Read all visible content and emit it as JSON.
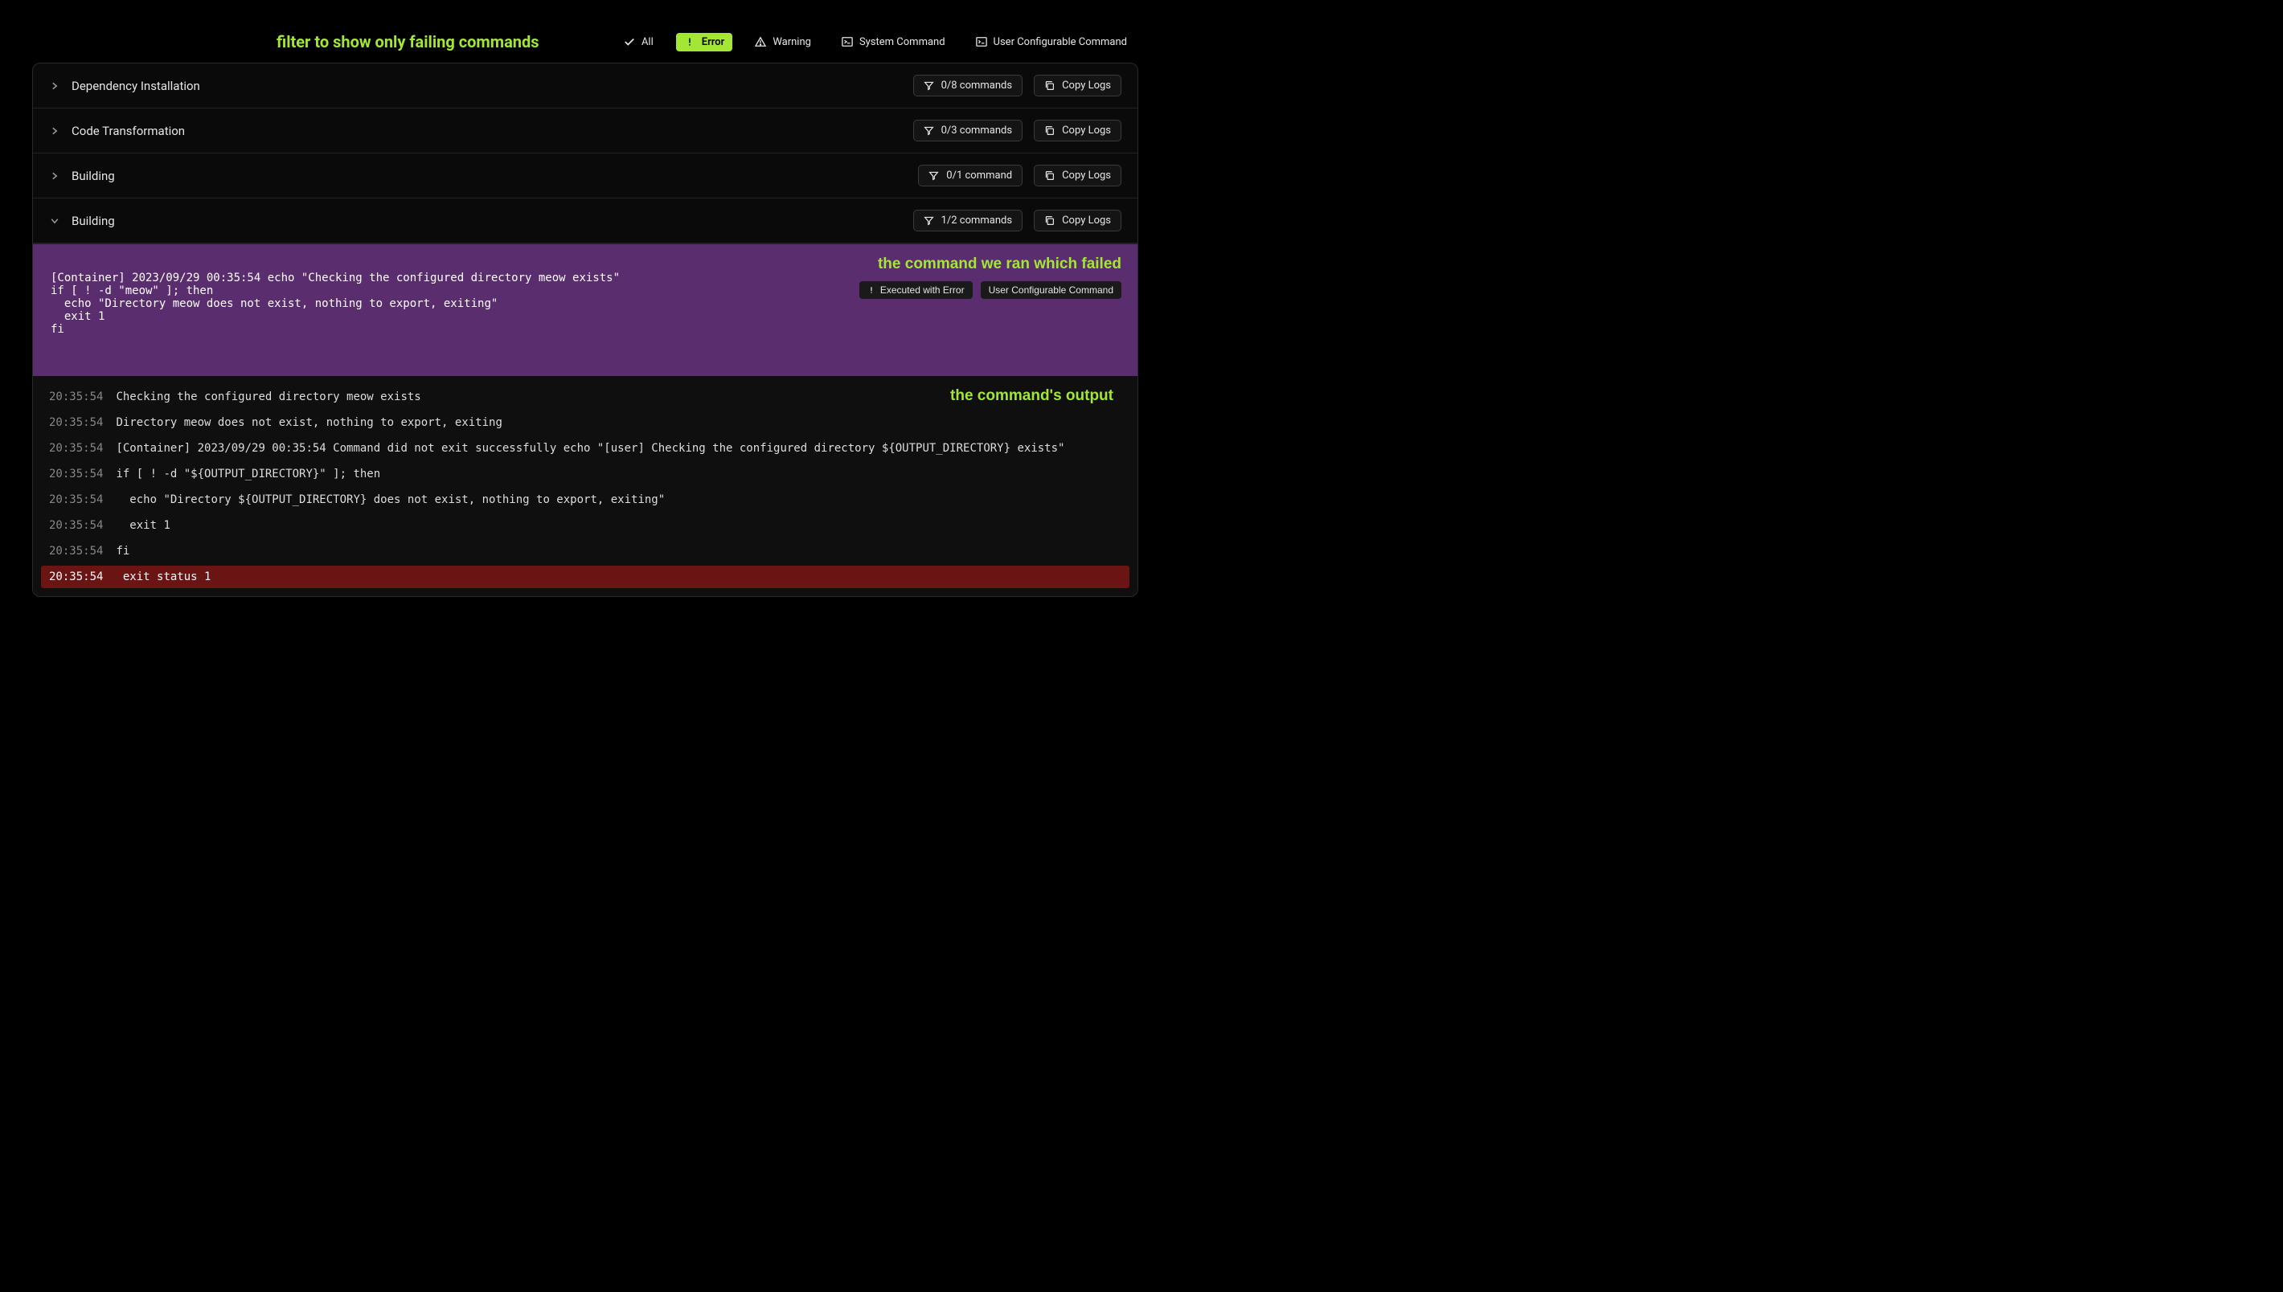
{
  "captions": {
    "filter_hint": "filter to show only failing commands",
    "failed_command": "the command we ran which failed",
    "command_output": "the command's output"
  },
  "filters": {
    "all": "All",
    "error": "Error",
    "warning": "Warning",
    "system_command": "System Command",
    "user_command": "User Configurable Command",
    "active": "error"
  },
  "sections": [
    {
      "title": "Dependency Installation",
      "expanded": false,
      "filtered": "0/8 commands",
      "copy": "Copy Logs"
    },
    {
      "title": "Code Transformation",
      "expanded": false,
      "filtered": "0/3 commands",
      "copy": "Copy Logs"
    },
    {
      "title": "Building",
      "expanded": false,
      "filtered": "0/1 command",
      "copy": "Copy Logs"
    },
    {
      "title": "Building",
      "expanded": true,
      "filtered": "1/2 commands",
      "copy": "Copy Logs"
    }
  ],
  "failing_command": {
    "text": "[Container] 2023/09/29 00:35:54 echo \"Checking the configured directory meow exists\"\nif [ ! -d \"meow\" ]; then\n  echo \"Directory meow does not exist, nothing to export, exiting\"\n  exit 1\nfi",
    "badges": {
      "status": "Executed with Error",
      "type": "User Configurable Command"
    }
  },
  "output": [
    {
      "ts": "20:35:54",
      "msg": "Checking the configured directory meow exists"
    },
    {
      "ts": "20:35:54",
      "msg": "Directory meow does not exist, nothing to export, exiting"
    },
    {
      "ts": "20:35:54",
      "msg": "[Container] 2023/09/29 00:35:54 Command did not exit successfully echo \"[user] Checking the configured directory ${OUTPUT_DIRECTORY} exists\""
    },
    {
      "ts": "20:35:54",
      "msg": "if [ ! -d \"${OUTPUT_DIRECTORY}\" ]; then"
    },
    {
      "ts": "20:35:54",
      "msg": "  echo \"Directory ${OUTPUT_DIRECTORY} does not exist, nothing to export, exiting\""
    },
    {
      "ts": "20:35:54",
      "msg": "  exit 1"
    },
    {
      "ts": "20:35:54",
      "msg": "fi"
    },
    {
      "ts": "20:35:54",
      "msg": " exit status 1",
      "error": true
    }
  ]
}
